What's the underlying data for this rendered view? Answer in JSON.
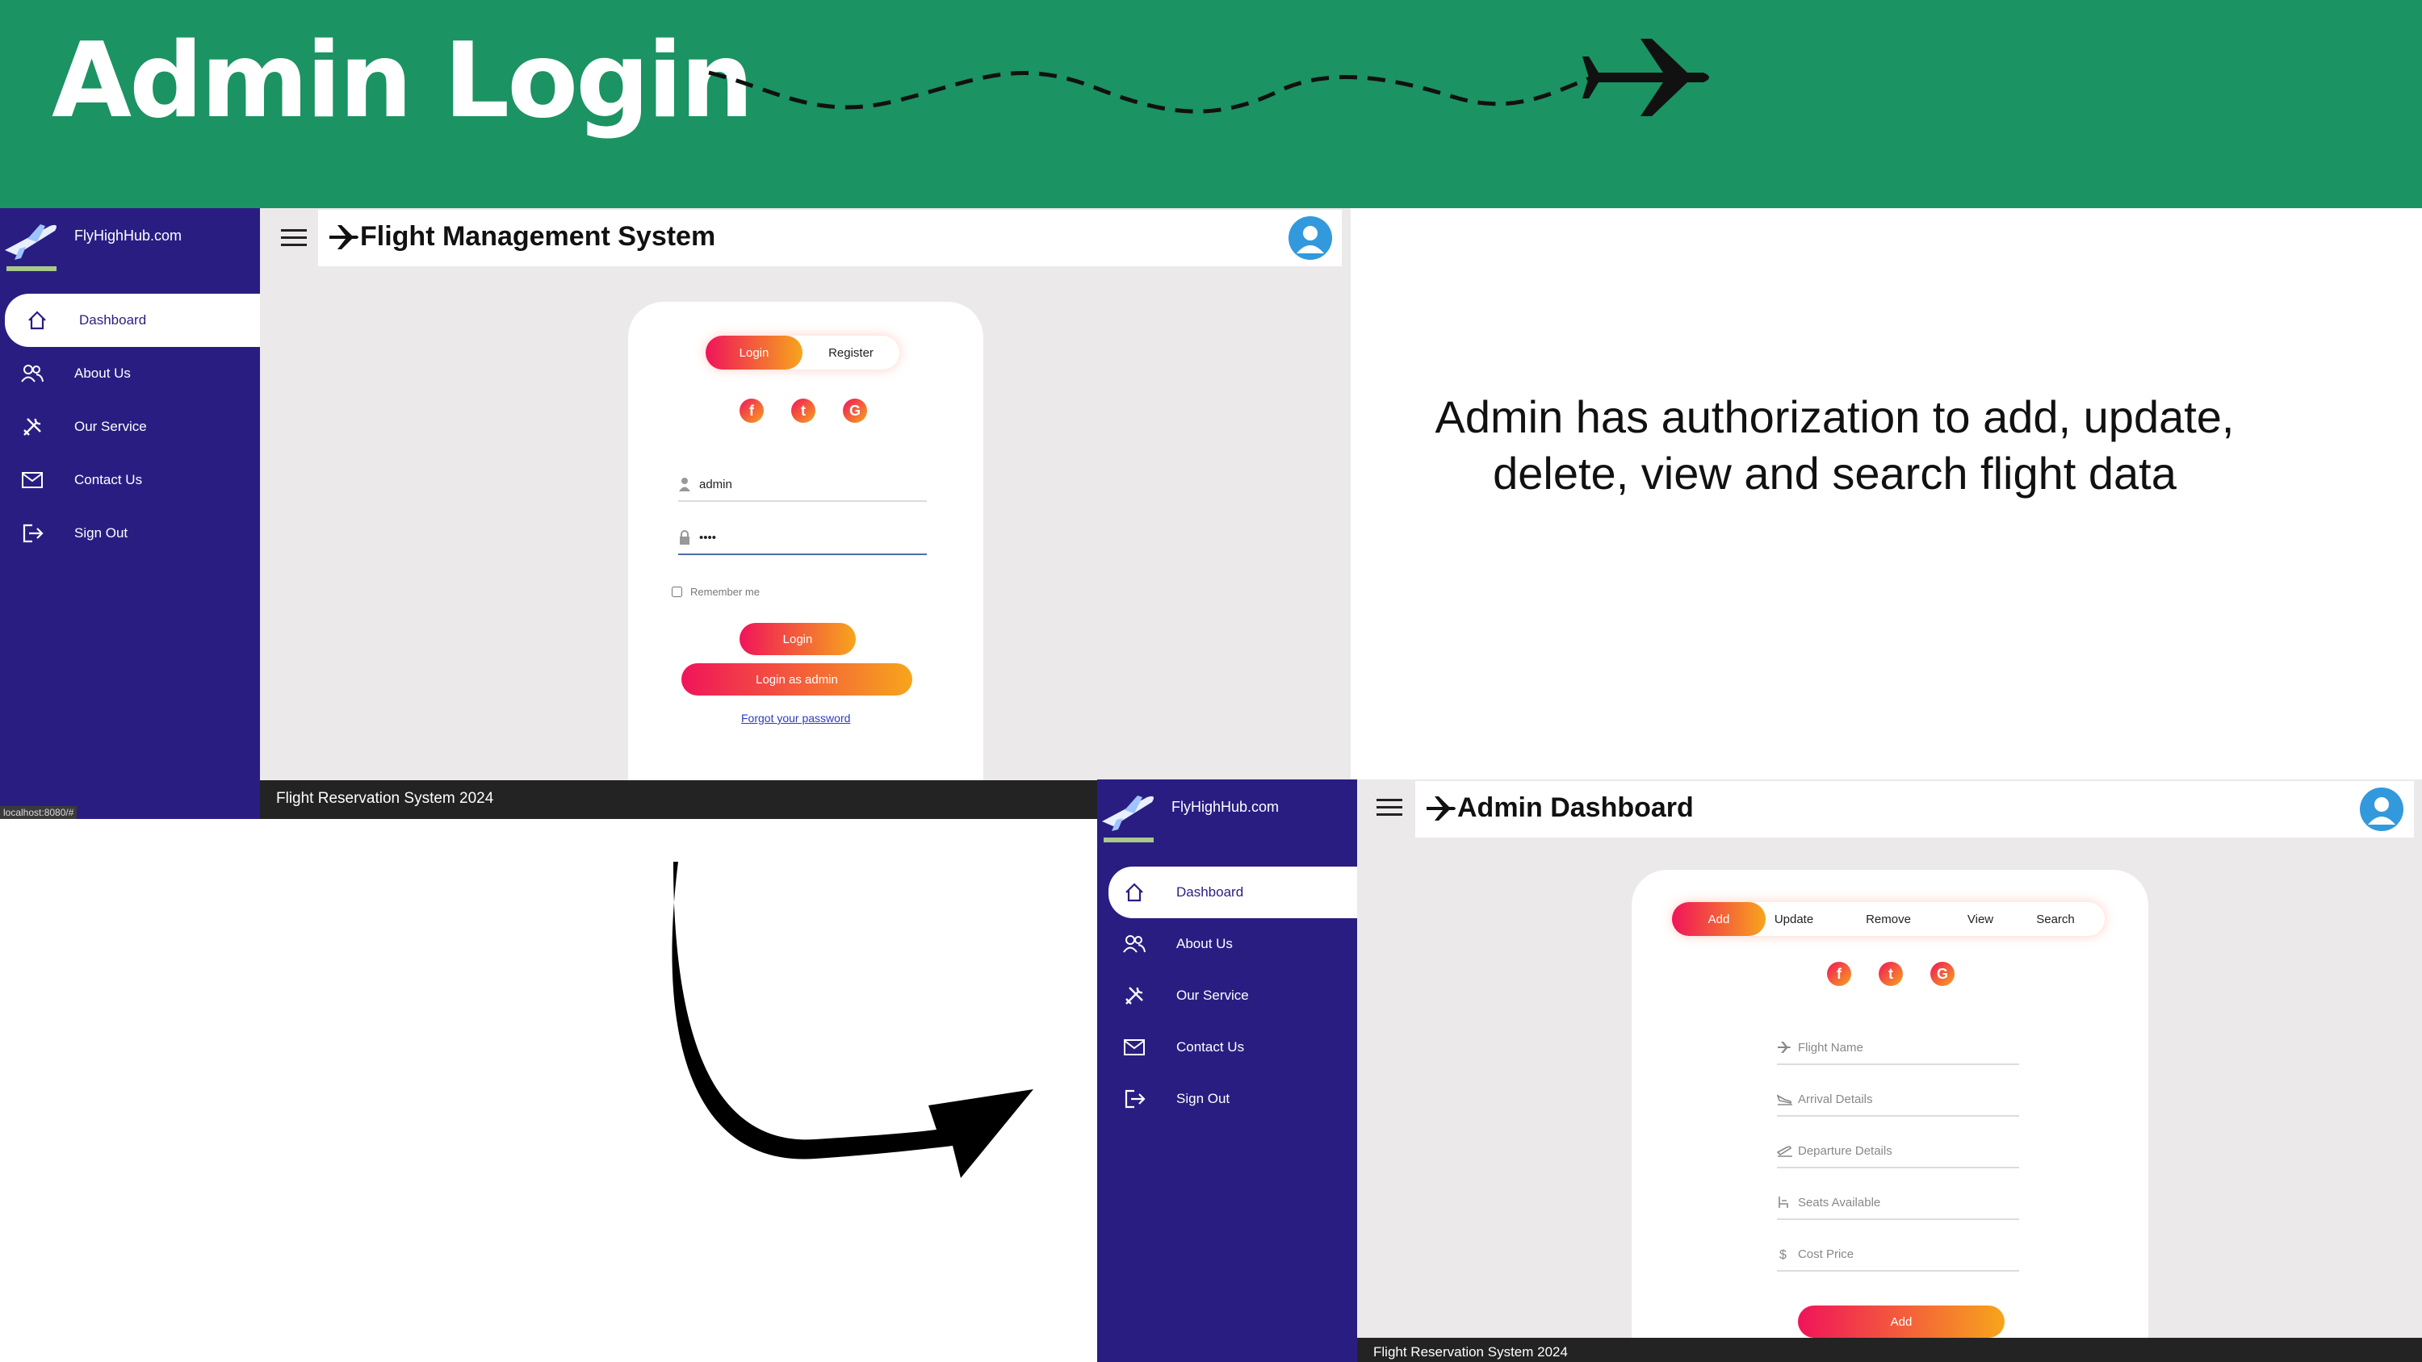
{
  "slide": {
    "title": "Admin Login",
    "caption": "Admin has authorization to add, update, delete, view and search flight data"
  },
  "colors": {
    "banner": "#1b9362",
    "sidebar": "#2a1d82",
    "gradient_start": "#f0145a",
    "gradient_end": "#f7a51c",
    "footer": "#232323"
  },
  "login_screen": {
    "brand": "FlyHighHub.com",
    "app_title": "Flight Management System",
    "nav": [
      {
        "label": "Dashboard",
        "icon": "home-icon",
        "active": true
      },
      {
        "label": "About Us",
        "icon": "users-icon"
      },
      {
        "label": "Our Service",
        "icon": "tools-icon"
      },
      {
        "label": "Contact Us",
        "icon": "mail-icon"
      },
      {
        "label": "Sign Out",
        "icon": "sign-out-icon"
      }
    ],
    "tabs": [
      "Login",
      "Register"
    ],
    "social": [
      "f",
      "t",
      "G"
    ],
    "username_value": "admin",
    "password_value": "••••",
    "remember_label": "Remember me",
    "login_button": "Login",
    "admin_button": "Login as admin",
    "forgot_link": "Forgot your password",
    "footer": "Flight Reservation System 2024",
    "status_url": "localhost:8080/#"
  },
  "admin_screen": {
    "brand": "FlyHighHub.com",
    "app_title": "Admin Dashboard",
    "nav": [
      {
        "label": "Dashboard",
        "icon": "home-icon",
        "active": true
      },
      {
        "label": "About Us",
        "icon": "users-icon"
      },
      {
        "label": "Our Service",
        "icon": "tools-icon"
      },
      {
        "label": "Contact Us",
        "icon": "mail-icon"
      },
      {
        "label": "Sign Out",
        "icon": "sign-out-icon"
      }
    ],
    "tabs": [
      "Add",
      "Update",
      "Remove",
      "View",
      "Search"
    ],
    "social": [
      "f",
      "t",
      "G"
    ],
    "fields": [
      {
        "placeholder": "Flight Name",
        "icon": "airplane-icon"
      },
      {
        "placeholder": "Arrival Details",
        "icon": "plane-landing-icon"
      },
      {
        "placeholder": "Departure Details",
        "icon": "plane-takeoff-icon"
      },
      {
        "placeholder": "Seats Available",
        "icon": "seat-icon"
      },
      {
        "placeholder": "Cost Price",
        "icon": "dollar-icon"
      }
    ],
    "submit_button": "Add",
    "footer": "Flight Reservation System 2024"
  }
}
